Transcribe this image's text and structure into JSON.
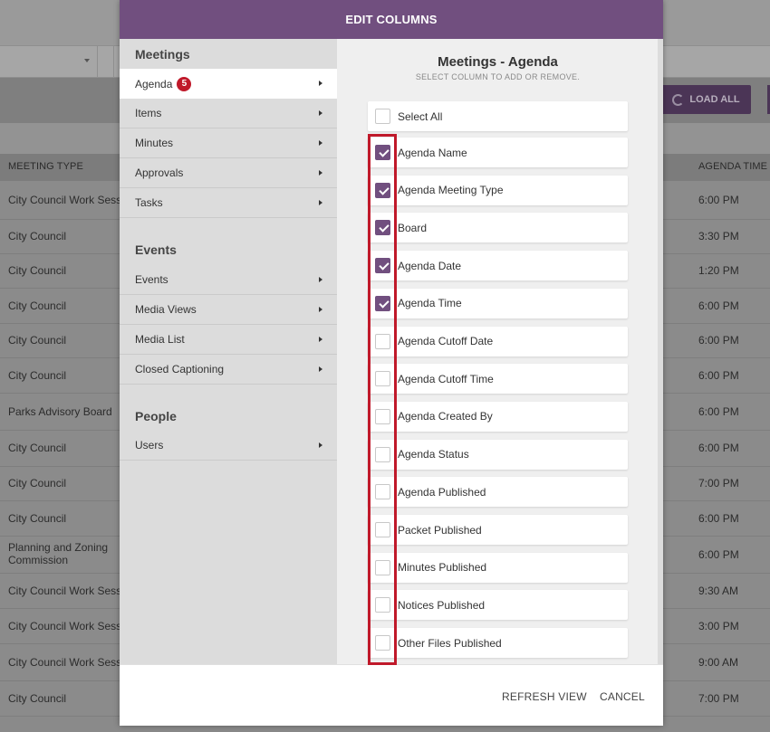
{
  "background": {
    "load_all_label": "LOAD ALL",
    "columns": {
      "meeting_type": "MEETING TYPE",
      "agenda_time": "AGENDA TIME"
    },
    "rows": [
      {
        "type": "City Council Work Session",
        "time": "6:00 PM"
      },
      {
        "type": "City Council",
        "time": "3:30 PM"
      },
      {
        "type": "City Council",
        "time": "1:20 PM"
      },
      {
        "type": "City Council",
        "time": "6:00 PM"
      },
      {
        "type": "City Council",
        "time": "6:00 PM"
      },
      {
        "type": "City Council",
        "time": "6:00 PM"
      },
      {
        "type": "Parks Advisory Board",
        "time": "6:00 PM"
      },
      {
        "type": "City Council",
        "time": "6:00 PM"
      },
      {
        "type": "City Council",
        "time": "7:00 PM"
      },
      {
        "type": "City Council",
        "time": "6:00 PM"
      },
      {
        "type": "Planning and Zoning Commission",
        "time": "6:00 PM"
      },
      {
        "type": "City Council Work Session",
        "time": "9:30 AM"
      },
      {
        "type": "City Council Work Session",
        "time": "3:00 PM"
      },
      {
        "type": "City Council Work Session",
        "time": "9:00 AM"
      },
      {
        "type": "City Council",
        "time": "7:00 PM"
      }
    ]
  },
  "modal": {
    "title": "EDIT COLUMNS",
    "nav": {
      "sections": [
        {
          "title": "Meetings",
          "items": [
            {
              "label": "Agenda",
              "badge": "5",
              "active": true
            },
            {
              "label": "Items"
            },
            {
              "label": "Minutes"
            },
            {
              "label": "Approvals"
            },
            {
              "label": "Tasks"
            }
          ]
        },
        {
          "title": "Events",
          "items": [
            {
              "label": "Events"
            },
            {
              "label": "Media Views"
            },
            {
              "label": "Media List"
            },
            {
              "label": "Closed Captioning"
            }
          ]
        },
        {
          "title": "People",
          "items": [
            {
              "label": "Users"
            }
          ]
        }
      ]
    },
    "content": {
      "title": "Meetings - Agenda",
      "subtitle": "SELECT COLUMN TO ADD OR REMOVE.",
      "select_all": "Select All",
      "columns": [
        {
          "label": "Agenda Name",
          "checked": true
        },
        {
          "label": "Agenda Meeting Type",
          "checked": true
        },
        {
          "label": "Board",
          "checked": true
        },
        {
          "label": "Agenda Date",
          "checked": true
        },
        {
          "label": "Agenda Time",
          "checked": true
        },
        {
          "label": "Agenda Cutoff Date",
          "checked": false
        },
        {
          "label": "Agenda Cutoff Time",
          "checked": false
        },
        {
          "label": "Agenda Created By",
          "checked": false
        },
        {
          "label": "Agenda Status",
          "checked": false
        },
        {
          "label": "Agenda Published",
          "checked": false
        },
        {
          "label": "Packet Published",
          "checked": false
        },
        {
          "label": "Minutes Published",
          "checked": false
        },
        {
          "label": "Notices Published",
          "checked": false
        },
        {
          "label": "Other Files Published",
          "checked": false
        }
      ]
    },
    "footer": {
      "refresh_label": "REFRESH VIEW",
      "cancel_label": "CANCEL"
    }
  },
  "colors": {
    "accent": "#714f7f",
    "badge": "#c0192a",
    "highlight": "#c0192a"
  }
}
